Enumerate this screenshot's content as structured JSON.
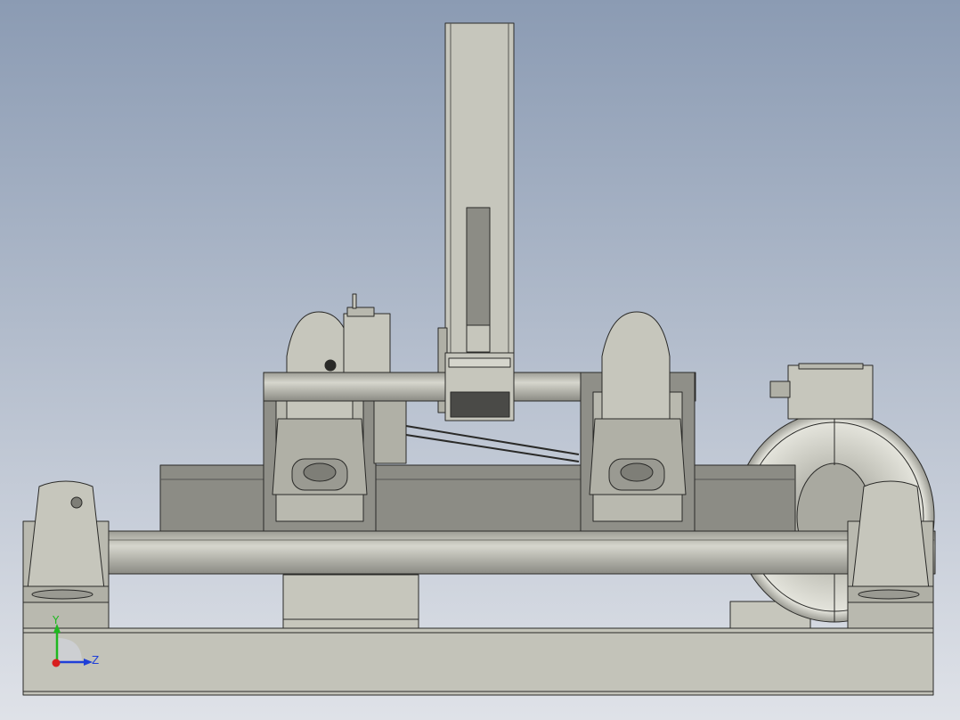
{
  "viewport": {
    "background_top": "#8b9bb3",
    "background_bottom": "#dfe2e8"
  },
  "model": {
    "part_fill": "#c6c6bc",
    "part_shade": "#a9a9a0",
    "part_dark": "#7e7e77",
    "edge_color": "#2a2a28"
  },
  "triad": {
    "y_label": "Y",
    "z_label": "Z",
    "y_color": "#1fb81f",
    "z_color": "#1f3fd8",
    "x_color": "#d81f1f"
  }
}
